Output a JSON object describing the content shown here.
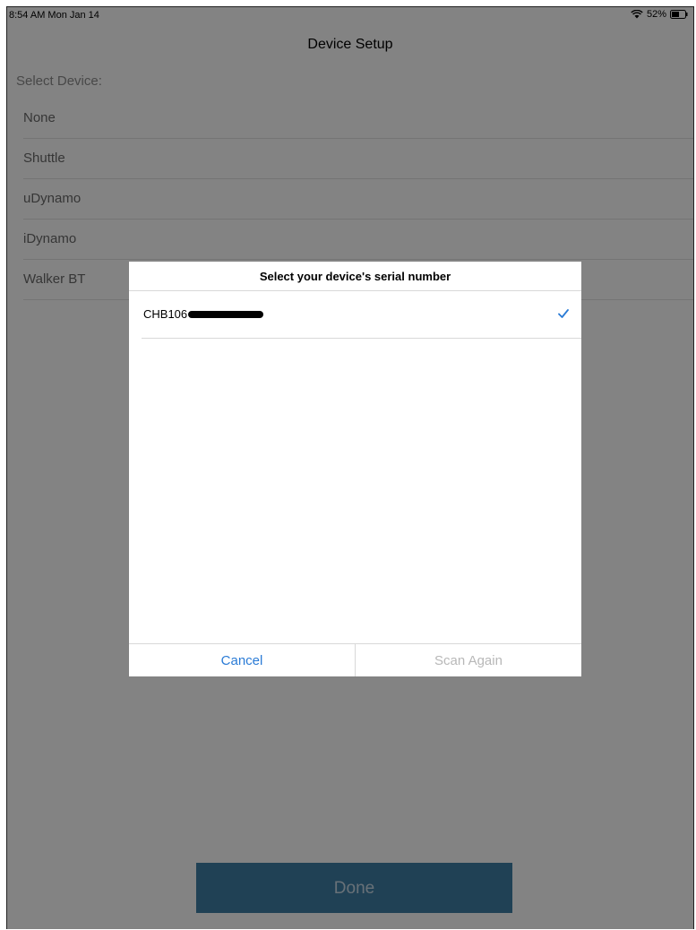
{
  "status_bar": {
    "time": "8:54 AM  Mon Jan 14",
    "battery": "52%"
  },
  "nav": {
    "title": "Device Setup"
  },
  "device_section": {
    "label": "Select Device:",
    "items": [
      {
        "label": "None"
      },
      {
        "label": "Shuttle"
      },
      {
        "label": "uDynamo"
      },
      {
        "label": "iDynamo"
      },
      {
        "label": "Walker BT"
      }
    ]
  },
  "done_button": {
    "label": "Done"
  },
  "dialog": {
    "title": "Select your device's serial number",
    "serials": [
      {
        "prefix": "CHB106",
        "selected": true,
        "check_icon": "checkmark-icon"
      }
    ],
    "cancel_label": "Cancel",
    "scan_again_label": "Scan Again"
  },
  "colors": {
    "accent": "#2a7bd6",
    "done_button": "#3d7ba0",
    "disabled_text": "#b8b8b8"
  }
}
